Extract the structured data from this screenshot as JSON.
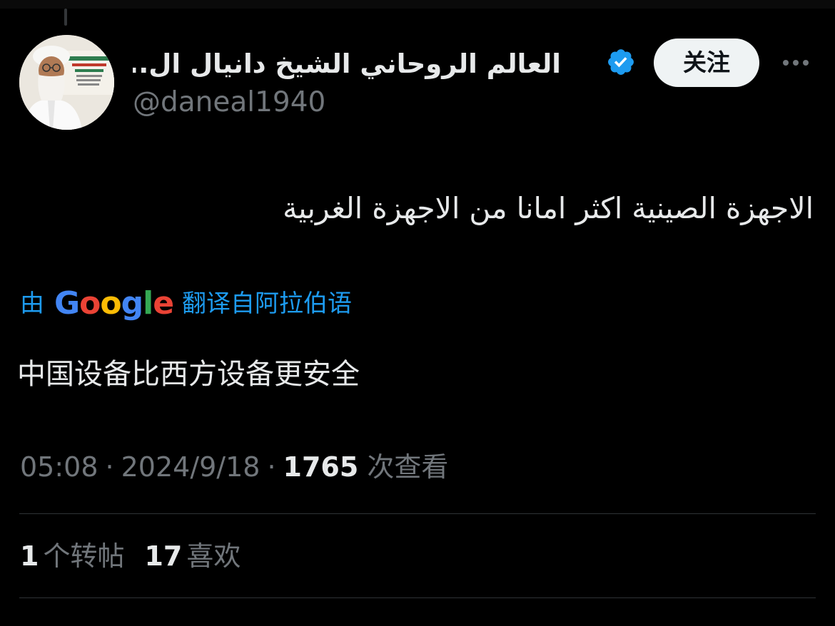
{
  "author": {
    "display_name": "العالم الروحاني الشيخ دانيال ال...",
    "handle": "@daneal1940",
    "verified": true,
    "avatar_icon": "elderly-man-photo-avatar"
  },
  "follow_button": {
    "label": "关注"
  },
  "more_button": {
    "icon": "more-horizontal-icon"
  },
  "tweet": {
    "text": "الاجهزة الصينية اكثر امانا من الاجهزة الغربية"
  },
  "translation": {
    "by_prefix": "由",
    "provider": "Google",
    "source_label": "翻译自阿拉伯语",
    "translated_text": "中国设备比西方设备更安全"
  },
  "meta": {
    "time": "05:08",
    "separator": "·",
    "date": "2024/9/18",
    "views_count": "1765",
    "views_label": "次查看"
  },
  "stats": {
    "reposts": {
      "count": "1",
      "label": "个转帖"
    },
    "likes": {
      "count": "17",
      "label": "喜欢"
    }
  },
  "colors": {
    "background": "#000000",
    "text_primary": "#e7e9ea",
    "text_secondary": "#71767b",
    "link_blue": "#1d9bf0",
    "verified_blue": "#1d9bf0",
    "divider": "#2f3336",
    "follow_button_bg": "#eff3f4"
  }
}
